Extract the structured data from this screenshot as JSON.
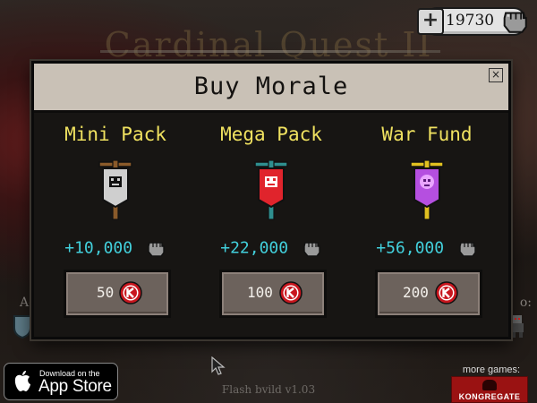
{
  "background": {
    "game_title": "Cardinal Quest II",
    "left_edge_text": "Ac",
    "right_edge_text": "o:"
  },
  "currency": {
    "amount": "19730",
    "plus_label": "+",
    "icon": "fist-icon"
  },
  "dialog": {
    "title": "Buy Morale",
    "close_label": "×",
    "packs": [
      {
        "name": "Mini Pack",
        "amount": "+10,000",
        "price": "50",
        "banner_color": "#c8c8c8",
        "icon": "fist-icon"
      },
      {
        "name": "Mega Pack",
        "amount": "+22,000",
        "price": "100",
        "banner_color": "#e0242c",
        "icon": "fist-icon"
      },
      {
        "name": "War Fund",
        "amount": "+56,000",
        "price": "200",
        "banner_color": "#b54fe0",
        "icon": "fist-icon"
      }
    ]
  },
  "footer": {
    "appstore_line1": "Download on the",
    "appstore_line2": "App Store",
    "build": "Flash bvild v1.03",
    "more_games": "more games:",
    "kongregate": "KONGREGATE"
  },
  "colors": {
    "pack_name": "#f0e260",
    "amount": "#42d0dc",
    "kred_coin": "#c8161e"
  }
}
